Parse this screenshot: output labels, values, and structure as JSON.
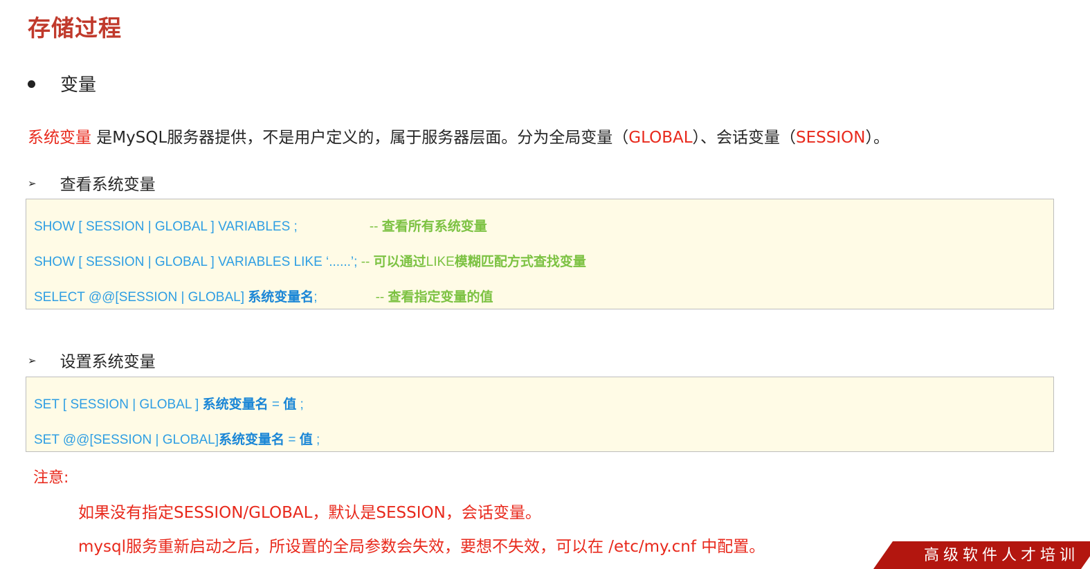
{
  "title": "存储过程",
  "bullet": "变量",
  "intro": {
    "term": "系统变量",
    "text1": " 是MySQL服务器提供，不是用户定义的，属于服务器层面。分为全局变量（",
    "global": "GLOBAL",
    "text2": "）、会话变量（",
    "session": "SESSION",
    "text3": "）。"
  },
  "view_section": {
    "heading": "查看系统变量",
    "lines": [
      {
        "code": "SHOW  [ SESSION | GLOBAL ]  VARIABLES ;",
        "comment_dash": "--",
        "comment": " 查看所有系统变量"
      },
      {
        "code": "SHOW  [ SESSION | GLOBAL ]  VARIABLES  LIKE  ‘......’;",
        "comment_dash": " --",
        "comment": " 可以通过",
        "comment_like": "LIKE",
        "comment_rest": "模糊匹配方式查找变量"
      },
      {
        "code": "SELECT  @@[SESSION | GLOBAL]  ",
        "code_bold": "系统变量名",
        "code_end": ";",
        "comment_dash": "--",
        "comment": "  查看指定变量的值"
      }
    ]
  },
  "set_section": {
    "heading": "设置系统变量",
    "lines": [
      {
        "code": "SET  [ SESSION | GLOBAL ]  ",
        "code_bold": "系统变量名",
        "code_eq": " = ",
        "code_val": "值",
        "code_end": " ;"
      },
      {
        "code": "SET  @@[SESSION | GLOBAL]",
        "code_bold": "系统变量名",
        "code_eq": " = ",
        "code_val": "值",
        "code_end": " ;"
      }
    ]
  },
  "note": {
    "label": "注意:",
    "lines": [
      "如果没有指定SESSION/GLOBAL，默认是SESSION，会话变量。",
      "mysql服务重新启动之后，所设置的全局参数会失效，要想不失效，可以在 /etc/my.cnf 中配置。"
    ]
  },
  "logo": {
    "text": "高级软件人才培训"
  },
  "colors": {
    "title": "#c0392b",
    "highlight_red": "#e8291c",
    "code_blue": "#2e9ee3",
    "comment_green": "#7cc242",
    "code_bg": "#fffbe6"
  }
}
